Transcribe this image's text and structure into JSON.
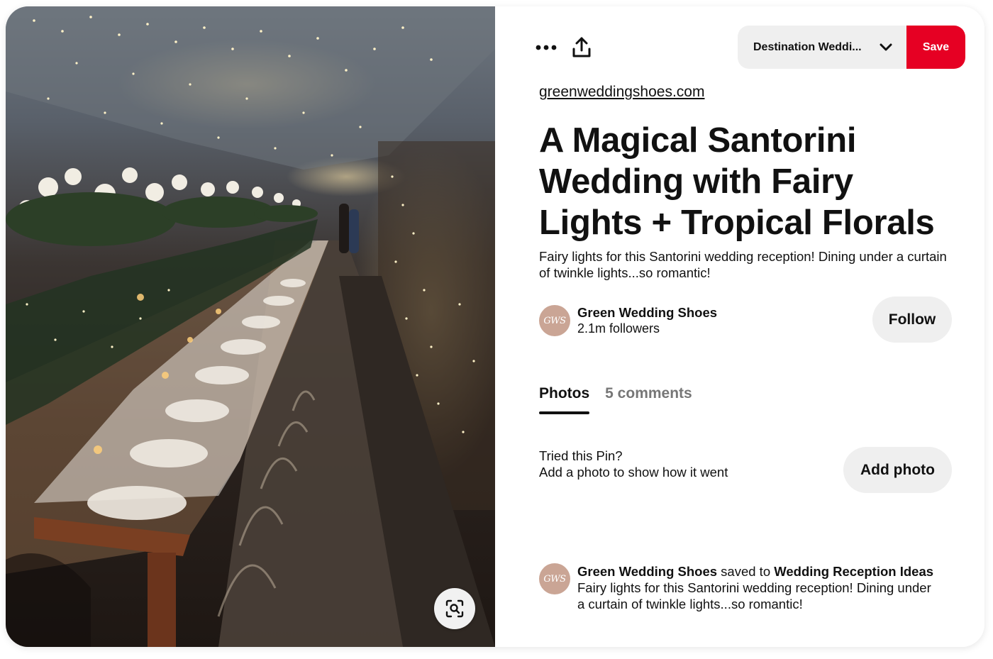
{
  "image": {
    "alt": "",
    "visual_search_icon": "visual-search-icon"
  },
  "toolbar": {
    "more_icon": "more-options-icon",
    "share_icon": "share-upload-icon",
    "board_select_label": "Destination Weddi...",
    "board_chevron_icon": "chevron-down-icon",
    "save_label": "Save"
  },
  "pin": {
    "source": "greenweddingshoes.com",
    "title": "A Magical Santorini Wedding with Fairy Lights + Tropical Florals",
    "description": "Fairy lights for this Santorini wedding reception! Dining under a curtain of twinkle lights...so romantic!"
  },
  "creator": {
    "avatar_text": "GWS",
    "name": "Green Wedding Shoes",
    "followers": "2.1m followers",
    "follow_label": "Follow"
  },
  "tabs": [
    {
      "label": "Photos",
      "active": true
    },
    {
      "label": "5 comments",
      "active": false
    }
  ],
  "tried": {
    "line1": "Tried this Pin?",
    "line2": "Add a photo to show how it went",
    "button_label": "Add photo"
  },
  "activity": {
    "avatar_text": "GWS",
    "user": "Green Wedding Shoes",
    "verb": "saved to",
    "board": "Wedding Reception Ideas",
    "description": "Fairy lights for this Santorini wedding reception! Dining under a curtain of twinkle lights...so romantic!"
  },
  "colors": {
    "save_red": "#e60023",
    "pill_gray": "#efefef",
    "muted_text": "#767676",
    "avatar_bg": "#caa595"
  }
}
